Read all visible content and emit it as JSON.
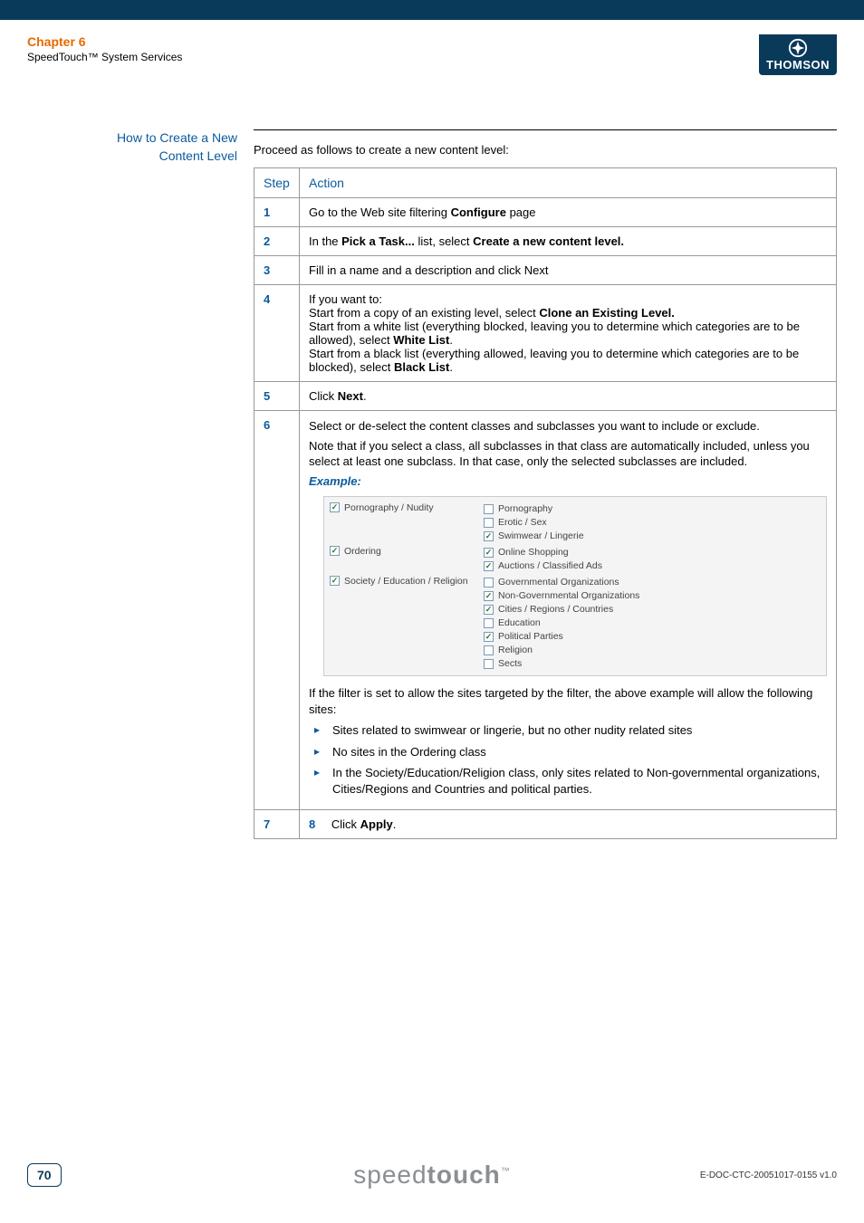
{
  "header": {
    "chapter": "Chapter 6",
    "subtitle": "SpeedTouch™ System Services",
    "brand": "THOMSON"
  },
  "side_heading_line1": "How to Create a New",
  "side_heading_line2": "Content Level",
  "intro": "Proceed as follows to create a new content level:",
  "table": {
    "head_step": "Step",
    "head_action": "Action",
    "rows": {
      "r1": {
        "num": "1",
        "action_pre": "Go to the Web site filtering ",
        "action_bold": "Configure",
        "action_post": " page"
      },
      "r2": {
        "num": "2",
        "pre": "In the ",
        "b1": "Pick a Task...",
        "mid": " list, select ",
        "b2": "Create a new content level."
      },
      "r3": {
        "num": "3",
        "text": "Fill in a name and a description and click Next"
      },
      "r4": {
        "num": "4",
        "l1": "If you want to:",
        "l2a": "Start from a copy of an existing level, select ",
        "l2b": "Clone an Existing Level.",
        "l3a": "Start from a white list (everything blocked, leaving you to determine which categories are to be allowed), select ",
        "l3b": "White List",
        "l3c": ".",
        "l4a": "Start from a black list (everything allowed, leaving you to determine which categories are to be blocked), select ",
        "l4b": "Black List",
        "l4c": "."
      },
      "r5": {
        "num": "5",
        "pre": "Click ",
        "b": "Next",
        "post": "."
      },
      "r6": {
        "num": "6",
        "p1": "Select or de-select the content classes and subclasses you want to include or exclude.",
        "p2": "Note that if you select a class, all subclasses in that class are automatically included, unless you select at least one subclass. In that case, only the selected subclasses are included.",
        "example_label": "Example:",
        "after_example": "If the filter is set to allow the sites targeted by the filter, the above example will allow the following sites:",
        "bullets": {
          "b1": "Sites related to swimwear or lingerie, but no other nudity related sites",
          "b2": "No sites in the Ordering class",
          "b3": "In the Society/Education/Religion class, only sites related to Non-governmental organizations, Cities/Regions and Countries and political parties."
        }
      },
      "r7": {
        "num": "7",
        "inner_num": "8",
        "pre": "Click ",
        "b": "Apply",
        "post": "."
      }
    }
  },
  "example": {
    "g1": {
      "label": "Pornography / Nudity",
      "checked": true,
      "subs": [
        {
          "label": "Pornography",
          "checked": false
        },
        {
          "label": "Erotic / Sex",
          "checked": false
        },
        {
          "label": "Swimwear / Lingerie",
          "checked": true
        }
      ]
    },
    "g2": {
      "label": "Ordering",
      "checked": true,
      "subs": [
        {
          "label": "Online Shopping",
          "checked": true
        },
        {
          "label": "Auctions / Classified Ads",
          "checked": true
        }
      ]
    },
    "g3": {
      "label": "Society / Education / Religion",
      "checked": true,
      "subs": [
        {
          "label": "Governmental Organizations",
          "checked": false
        },
        {
          "label": "Non-Governmental Organizations",
          "checked": true
        },
        {
          "label": "Cities / Regions / Countries",
          "checked": true
        },
        {
          "label": "Education",
          "checked": false
        },
        {
          "label": "Political Parties",
          "checked": true
        },
        {
          "label": "Religion",
          "checked": false
        },
        {
          "label": "Sects",
          "checked": false
        }
      ]
    }
  },
  "footer": {
    "page": "70",
    "brand_pre": "speed",
    "brand_bold": "touch",
    "brand_tm": "™",
    "docid": "E-DOC-CTC-20051017-0155 v1.0"
  }
}
